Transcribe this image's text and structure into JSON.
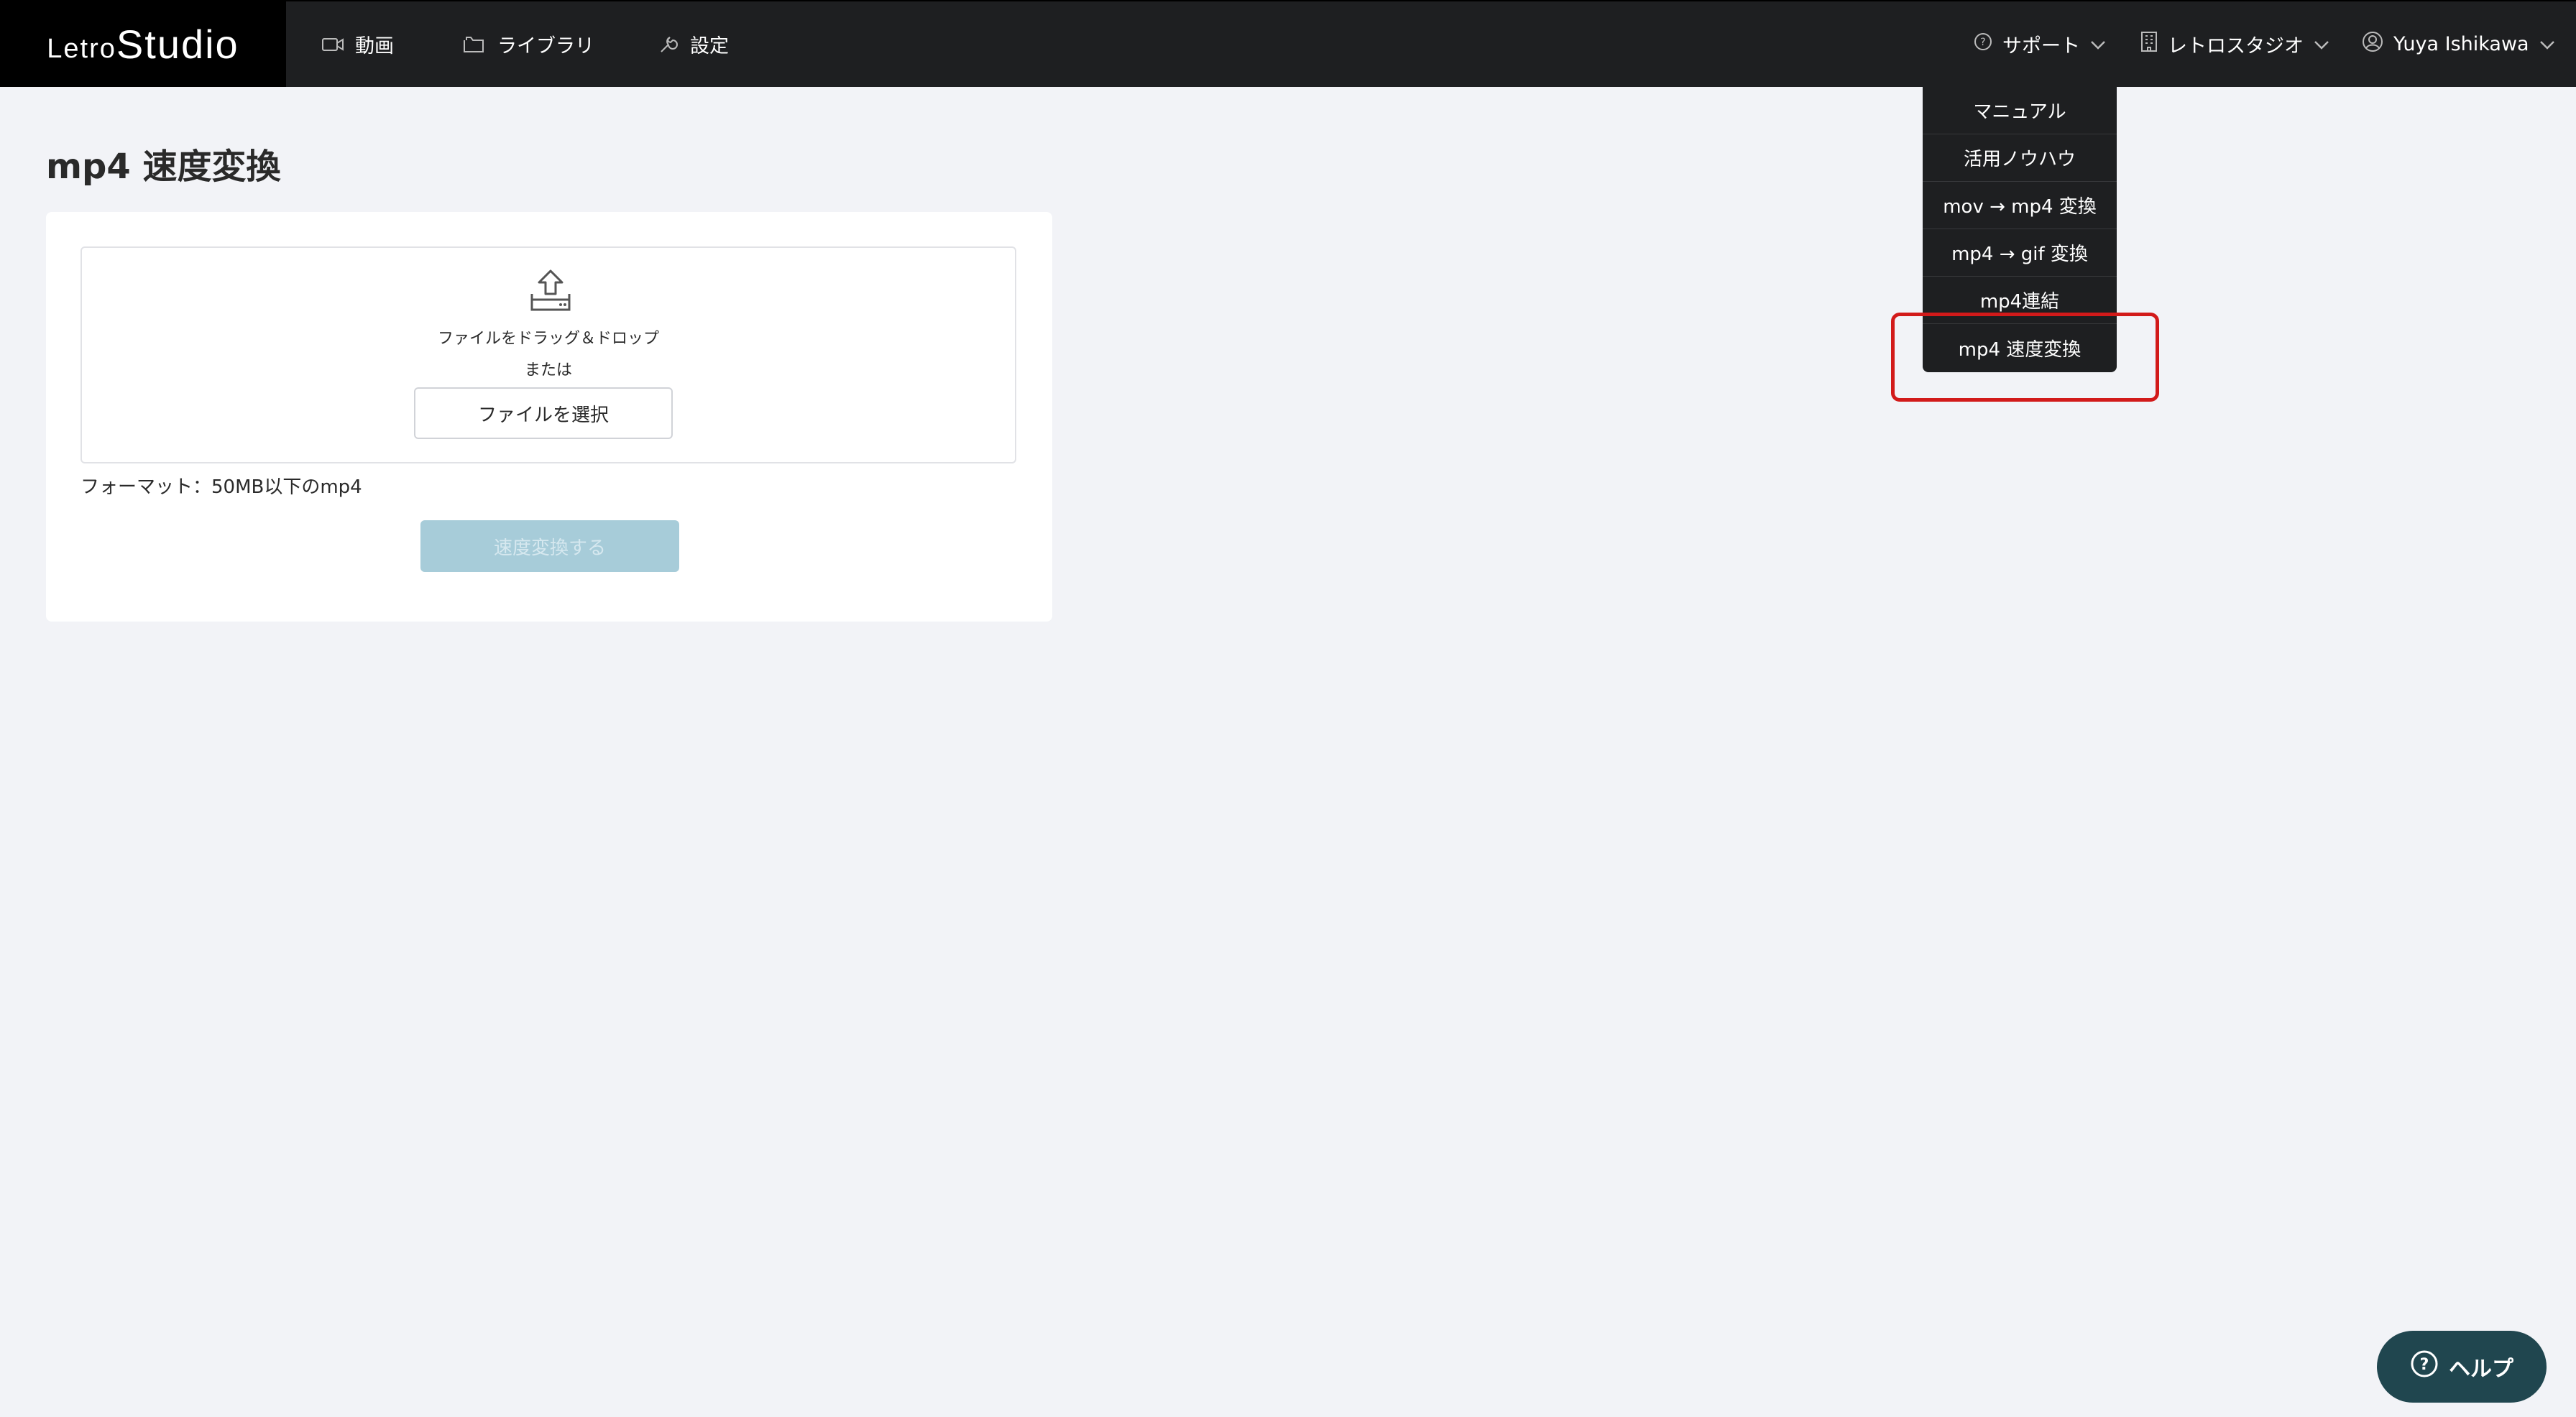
{
  "logo": {
    "part1": "Letro",
    "part2": "Studio"
  },
  "nav": [
    {
      "label": "動画",
      "icon": "video-icon"
    },
    {
      "label": "ライブラリ",
      "icon": "folder-icon"
    },
    {
      "label": "設定",
      "icon": "wrench-icon"
    }
  ],
  "header_right": {
    "support": "サポート",
    "org": "レトロスタジオ",
    "user": "Yuya Ishikawa"
  },
  "dropdown": {
    "items": [
      "マニュアル",
      "活用ノウハウ",
      "mov → mp4 変換",
      "mp4 → gif 変換",
      "mp4連結",
      "mp4 速度変換"
    ]
  },
  "page": {
    "title": "mp4 速度変換",
    "drop_text": "ファイルをドラッグ＆ドロップ",
    "or_text": "または",
    "select_button": "ファイルを選択",
    "format_text": "フォーマット：50MB以下のmp4",
    "convert_button": "速度変換する"
  },
  "help": {
    "label": "ヘルプ"
  },
  "colors": {
    "header": "#1e1f21",
    "highlight": "#d21a1a",
    "help": "#20464f",
    "disabled_button": "#a7ccd9"
  }
}
